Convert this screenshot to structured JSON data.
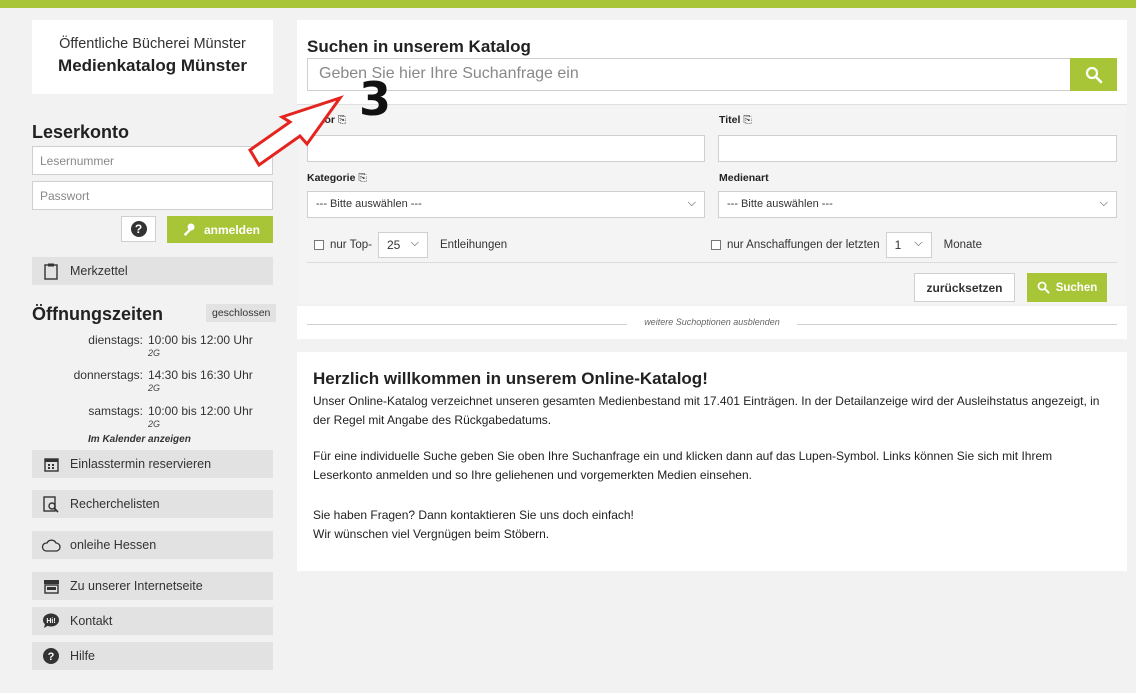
{
  "brand": {
    "small": "Öffentliche Bücherei Münster",
    "big": "Medienkatalog Münster"
  },
  "account": {
    "heading": "Leserkonto",
    "reader_placeholder": "Lesernummer",
    "password_placeholder": "Passwort",
    "help_icon": "?",
    "login_label": "anmelden"
  },
  "sidebar": {
    "merkzettel": "Merkzettel",
    "items": [
      {
        "label": "Einlasstermin reservieren",
        "icon": "calendar-icon"
      },
      {
        "label": "Recherchelisten",
        "icon": "list-search-icon"
      },
      {
        "label": "onleihe Hessen",
        "icon": "cloud-icon"
      },
      {
        "label": "Zu unserer Internetseite",
        "icon": "store-icon"
      },
      {
        "label": "Kontakt",
        "icon": "chat-hi-icon"
      },
      {
        "label": "Hilfe",
        "icon": "help-icon"
      }
    ]
  },
  "hours": {
    "heading": "Öffnungszeiten",
    "status": "geschlossen",
    "rows": [
      {
        "day": "dienstags:",
        "time": "10:00 bis 12:00 Uhr",
        "tag": "2G"
      },
      {
        "day": "donnerstags:",
        "time": "14:30 bis 16:30 Uhr",
        "tag": "2G"
      },
      {
        "day": "samstags:",
        "time": "10:00 bis 12:00 Uhr",
        "tag": "2G"
      }
    ],
    "calendar_link": "Im Kalender anzeigen"
  },
  "search": {
    "title": "Suchen in unserem Katalog",
    "placeholder": "Geben Sie hier Ihre Suchanfrage ein"
  },
  "advanced": {
    "author_label": "Autor",
    "title_label": "Titel",
    "category_label": "Kategorie",
    "media_label": "Medienart",
    "category_value": "--- Bitte auswählen ---",
    "media_value": "--- Bitte auswählen ---",
    "top_prefix": "nur Top-",
    "top_value": "25",
    "top_suffix": "Entleihungen",
    "acq_prefix": "nur Anschaffungen der letzten",
    "acq_value": "1",
    "acq_suffix": "Monate",
    "reset_label": "zurücksetzen",
    "search_label": "Suchen",
    "toggle_text": "weitere Suchoptionen ausblenden"
  },
  "welcome": {
    "title": "Herzlich willkommen in unserem Online-Katalog!",
    "p1": "Unser Online-Katalog verzeichnet unseren gesamten Medienbestand mit 17.401 Einträgen. In der Detailanzeige wird der Ausleihstatus angezeigt, in der Regel mit Angabe des Rückgabedatums.",
    "p2": "Für eine individuelle Suche geben Sie oben Ihre Suchanfrage ein und klicken dann auf das Lupen-Symbol. Links können Sie sich mit Ihrem Leserkonto anmelden und so Ihre geliehenen und vorgemerkten Medien einsehen.",
    "p3": "Sie haben Fragen? Dann kontaktieren Sie uns doch einfach!",
    "p4": "Wir wünschen viel Vergnügen beim Stöbern."
  },
  "annotation": {
    "number": "3",
    "color": "#e52420"
  },
  "colors": {
    "accent": "#a8c538"
  }
}
